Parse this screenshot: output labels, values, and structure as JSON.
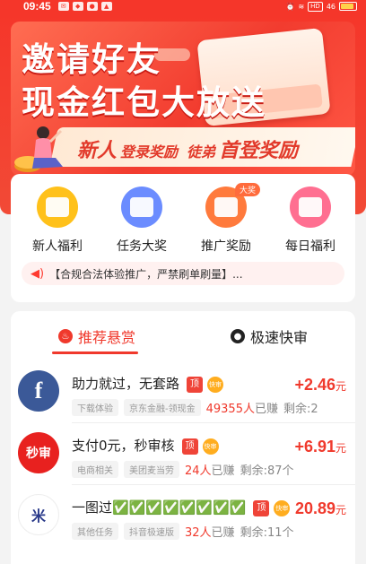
{
  "status_bar": {
    "time": "09:45",
    "network": "HD",
    "signal": "46"
  },
  "banner": {
    "line1": "邀请好友",
    "line2": "现金红包大放送",
    "promo": {
      "p1_big": "新人",
      "p1_small": "登录奖励",
      "p2_small": "徒弟",
      "p2_big": "首登奖励"
    }
  },
  "features": [
    {
      "label": "新人福利",
      "color": "#ffc11a",
      "badge": ""
    },
    {
      "label": "任务大奖",
      "color": "#6b8cff",
      "badge": ""
    },
    {
      "label": "推广奖励",
      "color": "#ff7a3c",
      "badge": "大奖"
    },
    {
      "label": "每日福利",
      "color": "#ff6f91",
      "badge": ""
    }
  ],
  "notice": "【合规合法体验推广，严禁刷单刷量】...",
  "tabs": [
    {
      "label": "推荐悬赏",
      "icon": "flame-icon"
    },
    {
      "label": "极速快审",
      "icon": "user-icon"
    }
  ],
  "tasks": [
    {
      "logo_text": "f",
      "logo_color": "#3b5998",
      "title": "助力就过，无套路",
      "top": "顶",
      "fast": "快审",
      "reward": "+2.46",
      "unit": "元",
      "tags": [
        "下载体验",
        "京东金融-领现金"
      ],
      "earned_count": "49355人",
      "earned_suffix": "已赚",
      "remaining": "剩余:2"
    },
    {
      "logo_text": "秒审",
      "logo_color": "#e8211f",
      "title": "支付0元，秒审核",
      "top": "顶",
      "fast": "快审",
      "reward": "+6.91",
      "unit": "元",
      "tags": [
        "电商相关",
        "美团麦当劳"
      ],
      "earned_count": "24人",
      "earned_suffix": "已赚",
      "remaining": "剩余:87个"
    },
    {
      "logo_text": "米",
      "logo_color": "#ffffff",
      "title": "一图过✅✅✅✅✅✅✅✅",
      "top": "顶",
      "fast": "快审",
      "reward": "20.89",
      "unit": "元",
      "tags": [
        "其他任务",
        "抖音极速版"
      ],
      "earned_count": "32人",
      "earned_suffix": "已赚",
      "remaining": "剩余:11个"
    }
  ]
}
